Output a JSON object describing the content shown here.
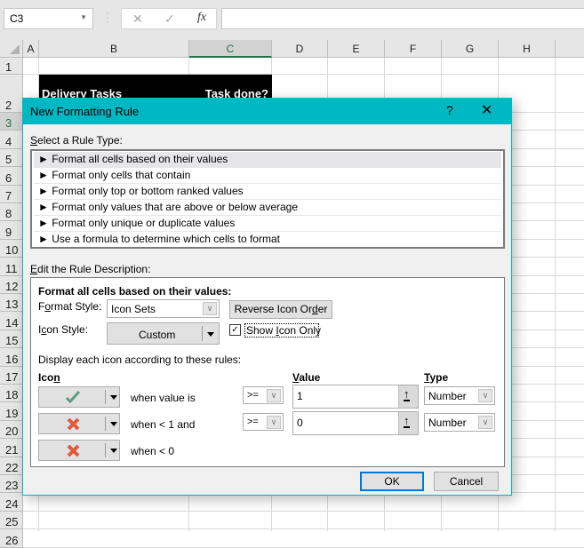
{
  "formula_bar": {
    "name_box": "C3",
    "cancel_icon": "✕",
    "enter_icon": "✓",
    "fx_label": "fx",
    "formula": ""
  },
  "grid": {
    "columns": [
      "A",
      "B",
      "C",
      "D",
      "E",
      "F",
      "G",
      "H"
    ],
    "selected_column": "C",
    "rows": [
      "1",
      "2",
      "3",
      "4",
      "5",
      "6",
      "7",
      "8",
      "9",
      "10",
      "11",
      "12",
      "13",
      "14",
      "15",
      "16",
      "17",
      "18",
      "19",
      "20",
      "21",
      "22",
      "23",
      "24",
      "25",
      "26"
    ],
    "cells": {
      "B2": "Delivery Tasks",
      "C2": "Task done?"
    },
    "header_band_color": "#000000"
  },
  "dialog": {
    "title": "New Formatting Rule",
    "help_label": "?",
    "close_label": "✕",
    "accent_color": "#00b7c3",
    "rule_type_label_prefix": "S",
    "rule_type_label_rest": "elect a Rule Type:",
    "rule_types": [
      {
        "label": "► Format all cells based on their values",
        "selected": true
      },
      {
        "label": "► Format only cells that contain",
        "selected": false
      },
      {
        "label": "► Format only top or bottom ranked values",
        "selected": false
      },
      {
        "label": "► Format only values that are above or below average",
        "selected": false
      },
      {
        "label": "► Format only unique or duplicate values",
        "selected": false
      },
      {
        "label": "► Use a formula to determine which cells to format",
        "selected": false
      }
    ],
    "edit_desc_prefix": "E",
    "edit_desc_rest": "dit the Rule Description:",
    "desc_heading": "Format all cells based on their values:",
    "format_style_label_a": "F",
    "format_style_label_u": "o",
    "format_style_label_b": "rmat Style:",
    "format_style_value": "Icon Sets",
    "reverse_a": "Reverse Icon Or",
    "reverse_u": "d",
    "reverse_b": "er",
    "icon_style_label_a": "I",
    "icon_style_label_u": "c",
    "icon_style_label_b": "on Style:",
    "icon_style_value": "Custom",
    "show_icon_only_a": "Show ",
    "show_icon_only_u": "I",
    "show_icon_only_b": "con Only",
    "show_icon_only_checked": true,
    "display_rules_label": "Display each icon according to these rules:",
    "col_icon_a": "Ico",
    "col_icon_u": "n",
    "col_value_u": "V",
    "col_value_b": "alue",
    "col_type_u": "T",
    "col_type_b": "ype",
    "icon_rules": [
      {
        "icon": "green-check",
        "condition": "when value is",
        "operator": ">=",
        "value": "1",
        "type": "Number"
      },
      {
        "icon": "red-x",
        "condition": "when < 1 and",
        "operator": ">=",
        "value": "0",
        "type": "Number"
      },
      {
        "icon": "red-x",
        "condition": "when < 0"
      }
    ],
    "ok_label": "OK",
    "cancel_label": "Cancel"
  }
}
